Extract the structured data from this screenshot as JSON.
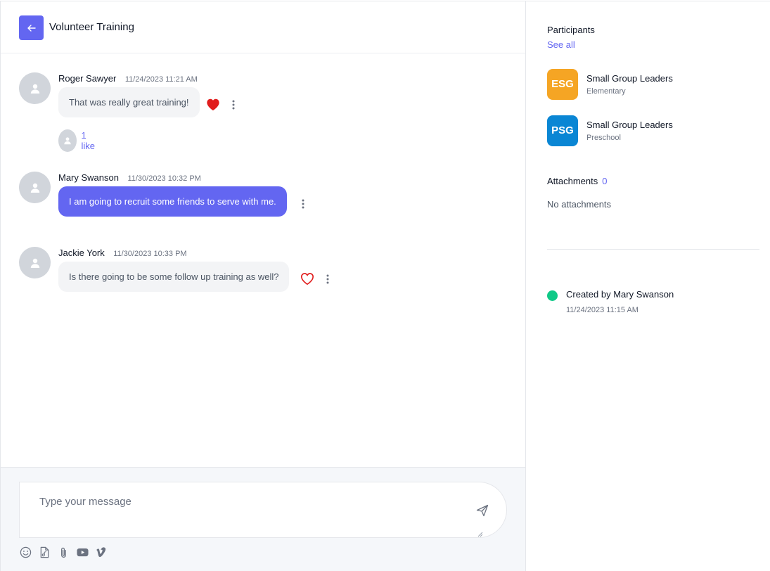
{
  "header": {
    "title": "Volunteer Training",
    "back_icon": "arrow-left-icon"
  },
  "messages": [
    {
      "author": "Roger Sawyer",
      "time": "11/24/2023 11:21 AM",
      "text": "That was really great training!",
      "liked": true,
      "likes_label": "1 like"
    },
    {
      "author": "Mary Swanson",
      "time": "11/30/2023 10:32 PM",
      "text": "I am going to recruit some friends to serve with me.",
      "mine": true
    },
    {
      "author": "Jackie York",
      "time": "11/30/2023 10:33 PM",
      "text": "Is there going to be some follow up training as well?",
      "liked": false
    }
  ],
  "composer": {
    "placeholder": "Type your message",
    "tools": [
      "emoji-icon",
      "file-icon",
      "paperclip-icon",
      "youtube-icon",
      "vimeo-icon"
    ],
    "send_icon": "send-icon"
  },
  "sidebar": {
    "participants_title": "Participants",
    "see_all": "See all",
    "groups": [
      {
        "badge": "ESG",
        "name": "Small Group Leaders",
        "sub": "Elementary",
        "color": "#f5a524"
      },
      {
        "badge": "PSG",
        "name": "Small Group Leaders",
        "sub": "Preschool",
        "color": "#0a86d4"
      }
    ],
    "attachments_title": "Attachments",
    "attachments_count": "0",
    "no_attachments": "No attachments",
    "created_by": "Created by Mary Swanson",
    "created_at": "11/24/2023 11:15 AM"
  },
  "colors": {
    "accent": "#6366f1",
    "heart": "#e11d1d",
    "online": "#10c987"
  }
}
